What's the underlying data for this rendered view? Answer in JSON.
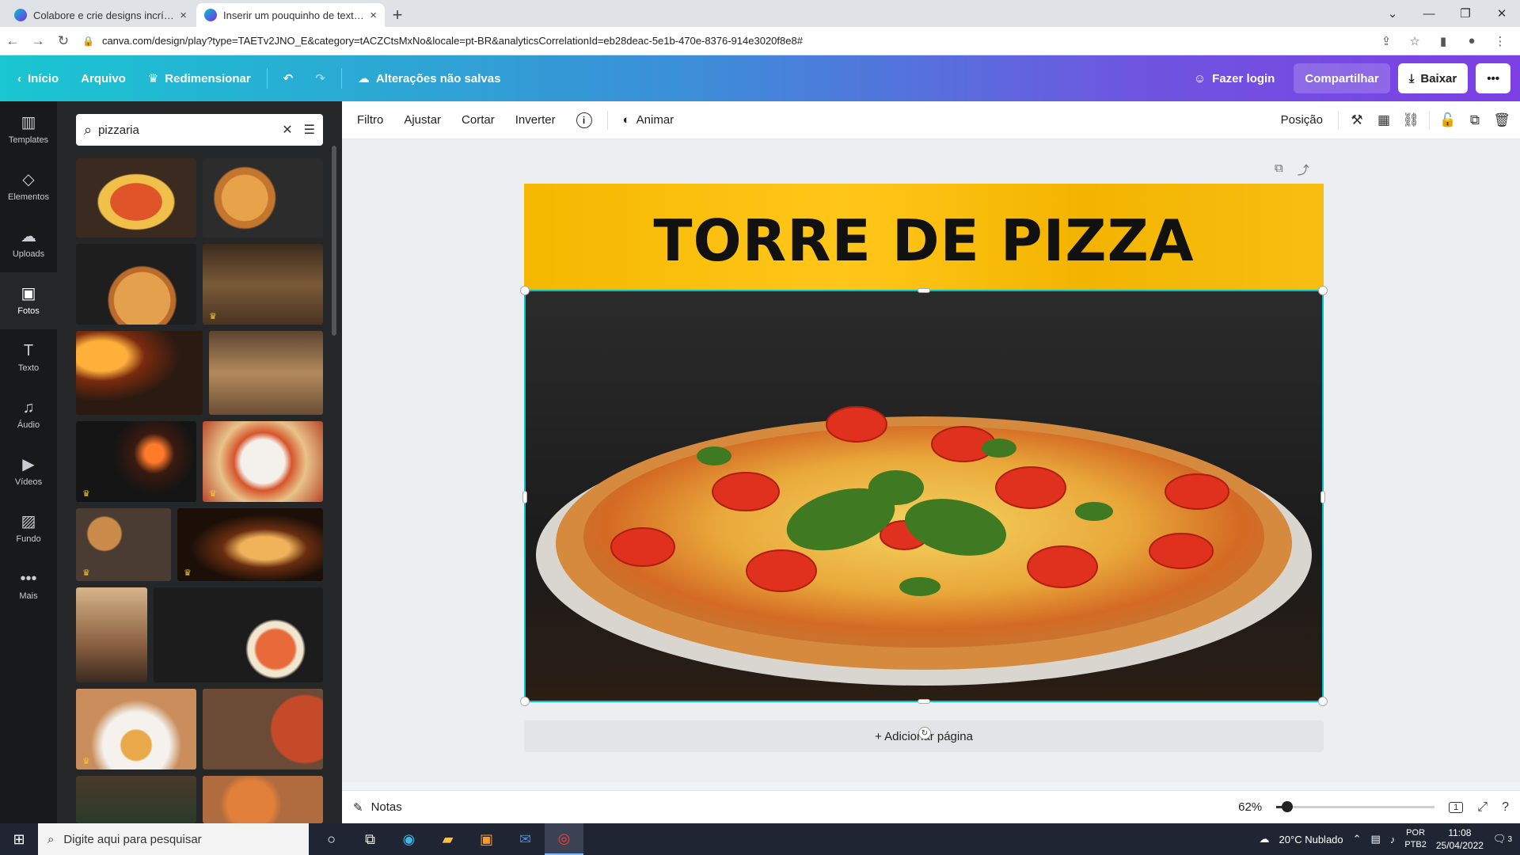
{
  "browser": {
    "tabs": [
      {
        "title": "Colabore e crie designs incríveis"
      },
      {
        "title": "Inserir um pouquinho de texto -"
      }
    ],
    "new_tab_symbol": "+",
    "close_symbol": "×",
    "url": "canva.com/design/play?type=TAETv2JNO_E&category=tACZCtsMxNo&locale=pt-BR&analyticsCorrelationId=eb28deac-5e1b-470e-8376-914e3020f8e8#"
  },
  "header": {
    "home": "Início",
    "file": "Arquivo",
    "resize": "Redimensionar",
    "status": "Alterações não salvas",
    "login": "Fazer login",
    "share": "Compartilhar",
    "download": "Baixar",
    "more": "•••"
  },
  "rail": {
    "items": [
      {
        "label": "Templates",
        "icon": "▥"
      },
      {
        "label": "Elementos",
        "icon": "◇"
      },
      {
        "label": "Uploads",
        "icon": "☁"
      },
      {
        "label": "Fotos",
        "icon": "▣"
      },
      {
        "label": "Texto",
        "icon": "T"
      },
      {
        "label": "Áudio",
        "icon": "♫"
      },
      {
        "label": "Vídeos",
        "icon": "▶"
      },
      {
        "label": "Fundo",
        "icon": "▨"
      },
      {
        "label": "Mais",
        "icon": "•••"
      }
    ]
  },
  "panel": {
    "search_value": "pizzaria",
    "search_icon": "⌕",
    "clear_icon": "✕",
    "filter_icon": "☰",
    "crown": "♛"
  },
  "toolbar": {
    "filter": "Filtro",
    "adjust": "Ajustar",
    "crop": "Cortar",
    "flip": "Inverter",
    "animate": "Animar",
    "position": "Posição"
  },
  "design": {
    "title": "TORRE DE PIZZA",
    "add_page": "+ Adicionar página"
  },
  "bottombar": {
    "notes": "Notas",
    "zoom": "62%",
    "zoom_fraction": 0.07,
    "page_count": "1"
  },
  "taskbar": {
    "search_placeholder": "Digite aqui para pesquisar",
    "weather": "20°C  Nublado",
    "lang_line1": "POR",
    "lang_line2": "PTB2",
    "time": "11:08",
    "date": "25/04/2022",
    "notifications": "3"
  },
  "colors": {
    "accent": "#00c4cc",
    "header_gradient_start": "#19c6d1",
    "header_gradient_end": "#7c3fe4",
    "design_yellow": "#f5b800",
    "rail_bg": "#18191b",
    "panel_bg": "#252627"
  }
}
